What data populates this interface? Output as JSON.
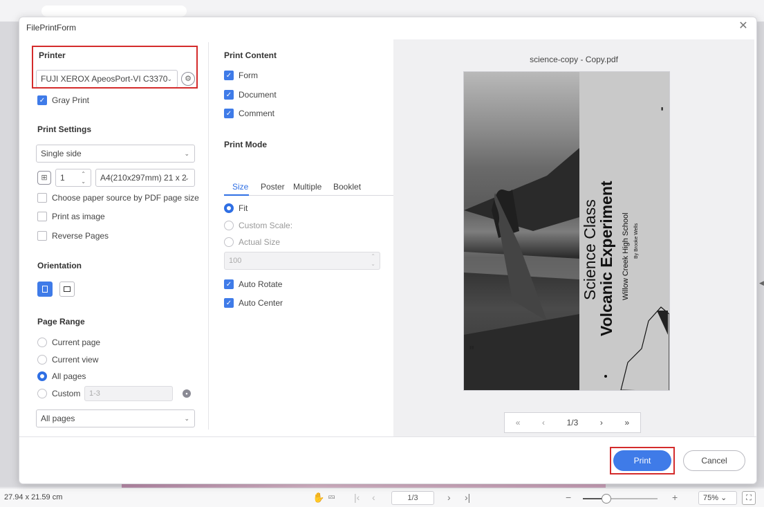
{
  "dialog": {
    "title": "FilePrintForm"
  },
  "printer": {
    "section_title": "Printer",
    "selected": "FUJI XEROX ApeosPort-VI C3370",
    "gray_print_label": "Gray Print",
    "gray_print_checked": true
  },
  "print_settings": {
    "section_title": "Print Settings",
    "sides": "Single side",
    "copies": "1",
    "paper": "A4(210x297mm) 21 x 2",
    "options": [
      {
        "label": "Choose paper source by PDF page size",
        "checked": false
      },
      {
        "label": "Print as image",
        "checked": false
      },
      {
        "label": "Reverse Pages",
        "checked": false
      }
    ]
  },
  "orientation": {
    "section_title": "Orientation",
    "selected": "portrait"
  },
  "page_range": {
    "section_title": "Page Range",
    "options": [
      {
        "label": "Current page",
        "selected": false
      },
      {
        "label": "Current view",
        "selected": false
      },
      {
        "label": "All pages",
        "selected": true
      },
      {
        "label": "Custom",
        "selected": false
      }
    ],
    "custom_placeholder": "1-3",
    "subset": "All pages"
  },
  "print_content": {
    "section_title": "Print Content",
    "options": [
      {
        "label": "Form",
        "checked": true
      },
      {
        "label": "Document",
        "checked": true
      },
      {
        "label": "Comment",
        "checked": true
      }
    ]
  },
  "print_mode": {
    "section_title": "Print Mode",
    "tabs": [
      "Size",
      "Poster",
      "Multiple",
      "Booklet"
    ],
    "active_tab": "Size",
    "size_options": [
      {
        "label": "Fit",
        "selected": true
      },
      {
        "label": "Custom Scale:",
        "selected": false
      },
      {
        "label": "Actual Size",
        "selected": false
      }
    ],
    "scale_value": "100",
    "auto_rotate_label": "Auto Rotate",
    "auto_rotate": true,
    "auto_center_label": "Auto Center",
    "auto_center": true
  },
  "preview": {
    "file_name": "science-copy - Copy.pdf",
    "page_indicator": "1/3",
    "doc_line1": "Science Class",
    "doc_line2": "Volcanic Experiment",
    "doc_line3": "Willow Creek High School",
    "doc_line4": "By Brooke Wells"
  },
  "footer": {
    "print_label": "Print",
    "cancel_label": "Cancel"
  },
  "status_bar": {
    "dimensions": "27.94 x 21.59 cm",
    "page_indicator": "1/3",
    "zoom": "75%"
  },
  "colors": {
    "accent": "#3f7be8",
    "highlight_box": "#d42b2b"
  }
}
